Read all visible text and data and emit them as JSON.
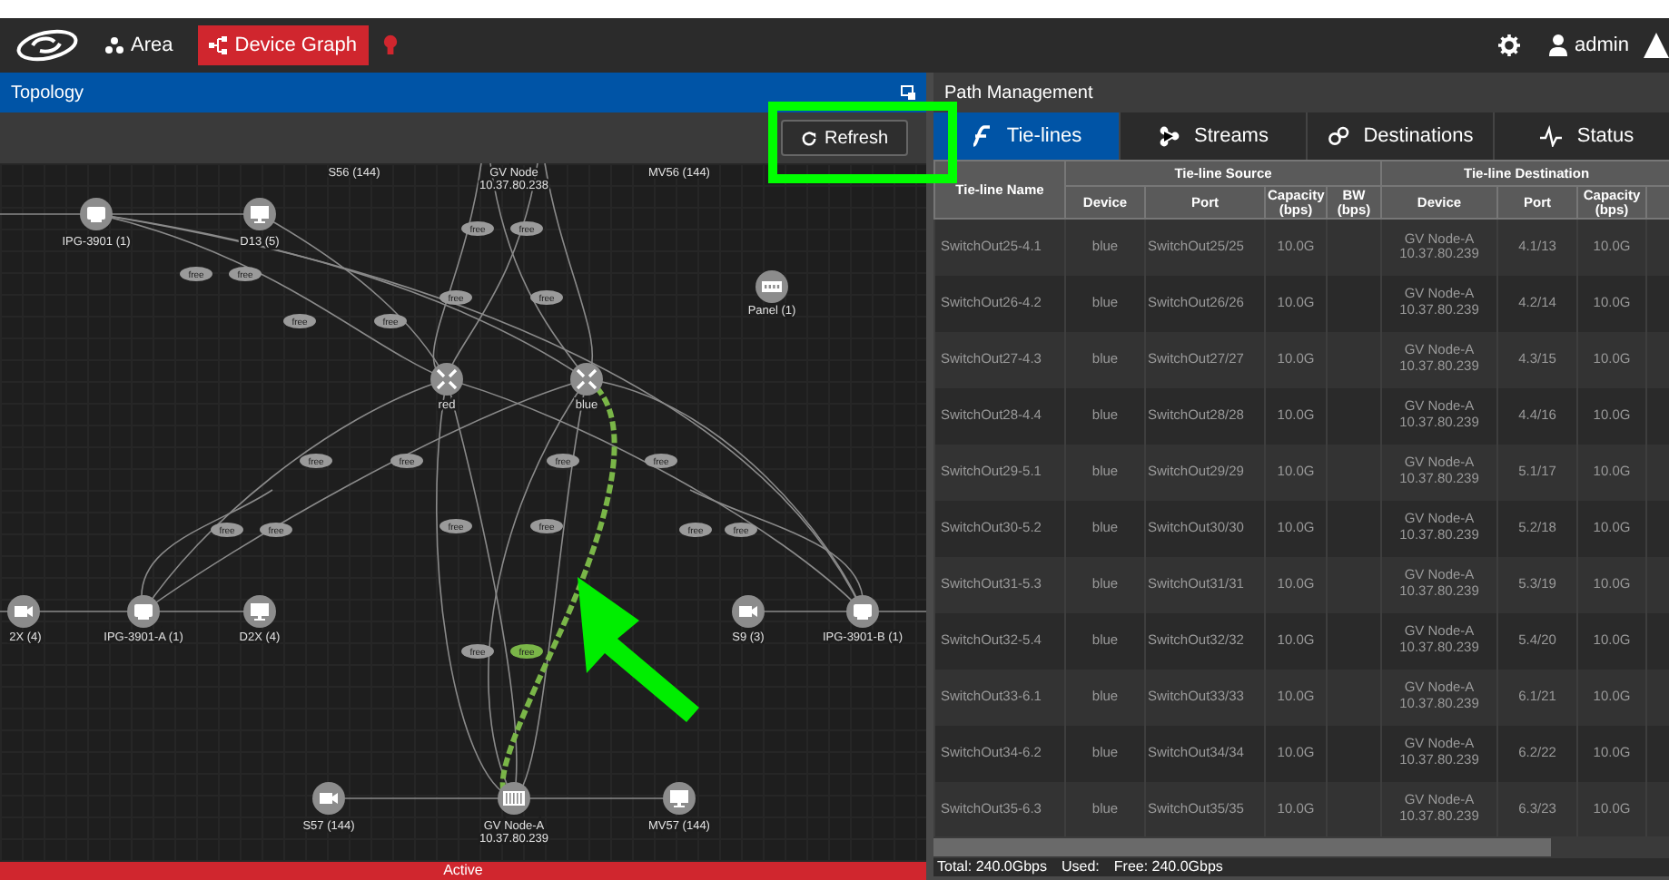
{
  "navbar": {
    "items": [
      {
        "label": "Area",
        "kind": "area",
        "selected": false
      },
      {
        "label": "Device Graph",
        "kind": "graph",
        "selected": true
      }
    ],
    "user": "admin"
  },
  "topology": {
    "title": "Topology",
    "refresh_button": "Refresh",
    "nodes": [
      {
        "label": "S56 (144)",
        "kind": "hidden"
      },
      {
        "label": "GV Node",
        "address": "10.37.80.238",
        "kind": "hidden"
      },
      {
        "label": "MV56 (144)",
        "kind": "hidden"
      },
      {
        "label": "IPG-3901 (1)",
        "kind": "gateway"
      },
      {
        "label": "D13 (5)",
        "kind": "monitor"
      },
      {
        "label": "Panel (1)",
        "kind": "panel"
      },
      {
        "label": "red",
        "kind": "router"
      },
      {
        "label": "blue",
        "kind": "router"
      },
      {
        "label": "2X (4)",
        "kind": "camera"
      },
      {
        "label": "IPG-3901-A (1)",
        "kind": "gateway"
      },
      {
        "label": "D2X (4)",
        "kind": "monitor"
      },
      {
        "label": "S9 (3)",
        "kind": "camera"
      },
      {
        "label": "IPG-3901-B (1)",
        "kind": "gateway"
      },
      {
        "label": "S57 (144)",
        "kind": "camera"
      },
      {
        "label": "GV Node-A",
        "address": "10.37.80.239",
        "kind": "rack"
      },
      {
        "label": "MV57 (144)",
        "kind": "monitor"
      }
    ],
    "link_labels": [
      {
        "text": "free",
        "selected": false
      },
      {
        "text": "free",
        "selected": false
      },
      {
        "text": "free",
        "selected": false
      },
      {
        "text": "free",
        "selected": false
      },
      {
        "text": "free",
        "selected": false
      },
      {
        "text": "free",
        "selected": false
      },
      {
        "text": "free",
        "selected": false
      },
      {
        "text": "free",
        "selected": false
      },
      {
        "text": "free",
        "selected": false
      },
      {
        "text": "free",
        "selected": false
      },
      {
        "text": "free",
        "selected": false
      },
      {
        "text": "free",
        "selected": false
      },
      {
        "text": "free",
        "selected": false
      },
      {
        "text": "free",
        "selected": false
      },
      {
        "text": "free",
        "selected": false
      },
      {
        "text": "free",
        "selected": false
      },
      {
        "text": "free",
        "selected": false
      },
      {
        "text": "free",
        "selected": false
      },
      {
        "text": "free",
        "selected": false
      },
      {
        "text": "free",
        "selected": true
      }
    ],
    "status": "Active"
  },
  "path_management": {
    "title": "Path Management",
    "tabs": [
      {
        "label": "Tie-lines",
        "kind": "tielines",
        "selected": true
      },
      {
        "label": "Streams",
        "kind": "streams",
        "selected": false
      },
      {
        "label": "Destinations",
        "kind": "destinations",
        "selected": false
      },
      {
        "label": "Status",
        "kind": "status",
        "selected": false
      }
    ],
    "table": {
      "first_column": "Tie-line Name",
      "groups": [
        "Tie-line Source",
        "Tie-line Destination"
      ],
      "source_columns": [
        "Device",
        "Port",
        "Capacity (bps)",
        "BW (bps)"
      ],
      "destination_columns": [
        "Device",
        "Port",
        "Capacity (bps)"
      ],
      "rows": [
        {
          "name": "SwitchOut25-4.1",
          "device": "blue",
          "port": "SwitchOut25/25",
          "capacity": "10.0G",
          "dest_device": "GV Node-A\n10.37.80.239",
          "dest_port": "4.1/13",
          "dest_capacity": "10.0G"
        },
        {
          "name": "SwitchOut26-4.2",
          "device": "blue",
          "port": "SwitchOut26/26",
          "capacity": "10.0G",
          "dest_device": "GV Node-A\n10.37.80.239",
          "dest_port": "4.2/14",
          "dest_capacity": "10.0G"
        },
        {
          "name": "SwitchOut27-4.3",
          "device": "blue",
          "port": "SwitchOut27/27",
          "capacity": "10.0G",
          "dest_device": "GV Node-A\n10.37.80.239",
          "dest_port": "4.3/15",
          "dest_capacity": "10.0G"
        },
        {
          "name": "SwitchOut28-4.4",
          "device": "blue",
          "port": "SwitchOut28/28",
          "capacity": "10.0G",
          "dest_device": "GV Node-A\n10.37.80.239",
          "dest_port": "4.4/16",
          "dest_capacity": "10.0G"
        },
        {
          "name": "SwitchOut29-5.1",
          "device": "blue",
          "port": "SwitchOut29/29",
          "capacity": "10.0G",
          "dest_device": "GV Node-A\n10.37.80.239",
          "dest_port": "5.1/17",
          "dest_capacity": "10.0G"
        },
        {
          "name": "SwitchOut30-5.2",
          "device": "blue",
          "port": "SwitchOut30/30",
          "capacity": "10.0G",
          "dest_device": "GV Node-A\n10.37.80.239",
          "dest_port": "5.2/18",
          "dest_capacity": "10.0G"
        },
        {
          "name": "SwitchOut31-5.3",
          "device": "blue",
          "port": "SwitchOut31/31",
          "capacity": "10.0G",
          "dest_device": "GV Node-A\n10.37.80.239",
          "dest_port": "5.3/19",
          "dest_capacity": "10.0G"
        },
        {
          "name": "SwitchOut32-5.4",
          "device": "blue",
          "port": "SwitchOut32/32",
          "capacity": "10.0G",
          "dest_device": "GV Node-A\n10.37.80.239",
          "dest_port": "5.4/20",
          "dest_capacity": "10.0G"
        },
        {
          "name": "SwitchOut33-6.1",
          "device": "blue",
          "port": "SwitchOut33/33",
          "capacity": "10.0G",
          "dest_device": "GV Node-A\n10.37.80.239",
          "dest_port": "6.1/21",
          "dest_capacity": "10.0G"
        },
        {
          "name": "SwitchOut34-6.2",
          "device": "blue",
          "port": "SwitchOut34/34",
          "capacity": "10.0G",
          "dest_device": "GV Node-A\n10.37.80.239",
          "dest_port": "6.2/22",
          "dest_capacity": "10.0G"
        },
        {
          "name": "SwitchOut35-6.3",
          "device": "blue",
          "port": "SwitchOut35/35",
          "capacity": "10.0G",
          "dest_device": "GV Node-A\n10.37.80.239",
          "dest_port": "6.3/23",
          "dest_capacity": "10.0G"
        }
      ]
    },
    "footer": [
      "Total: 240.0Gbps",
      "Used:",
      "Free: 240.0Gbps"
    ]
  }
}
